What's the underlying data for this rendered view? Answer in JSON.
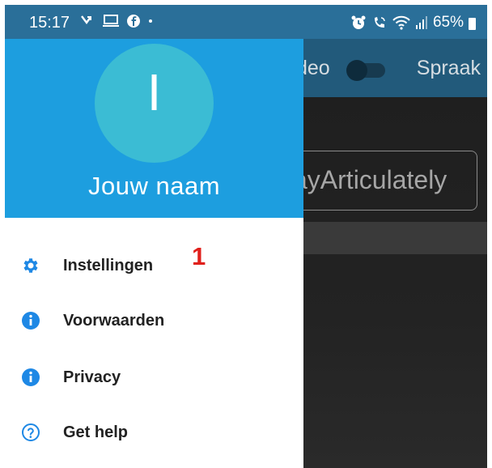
{
  "status_bar": {
    "time": "15:17",
    "battery": "65%",
    "bg_color": "#2a6f99"
  },
  "app": {
    "toolbar_left": "deo",
    "toolbar_right": "Spraak",
    "brand": "ayArticulately"
  },
  "drawer": {
    "header_color": "#1d9edf",
    "avatar_initial": "I",
    "user_name": "Jouw naam",
    "items": [
      {
        "label": "Instellingen",
        "icon": "gear-icon"
      },
      {
        "label": "Voorwaarden",
        "icon": "info-icon"
      },
      {
        "label": "Privacy",
        "icon": "info-icon"
      },
      {
        "label": "Get help",
        "icon": "help-circle-icon"
      }
    ],
    "annotation": "1",
    "icon_color": "#1e88e5"
  }
}
